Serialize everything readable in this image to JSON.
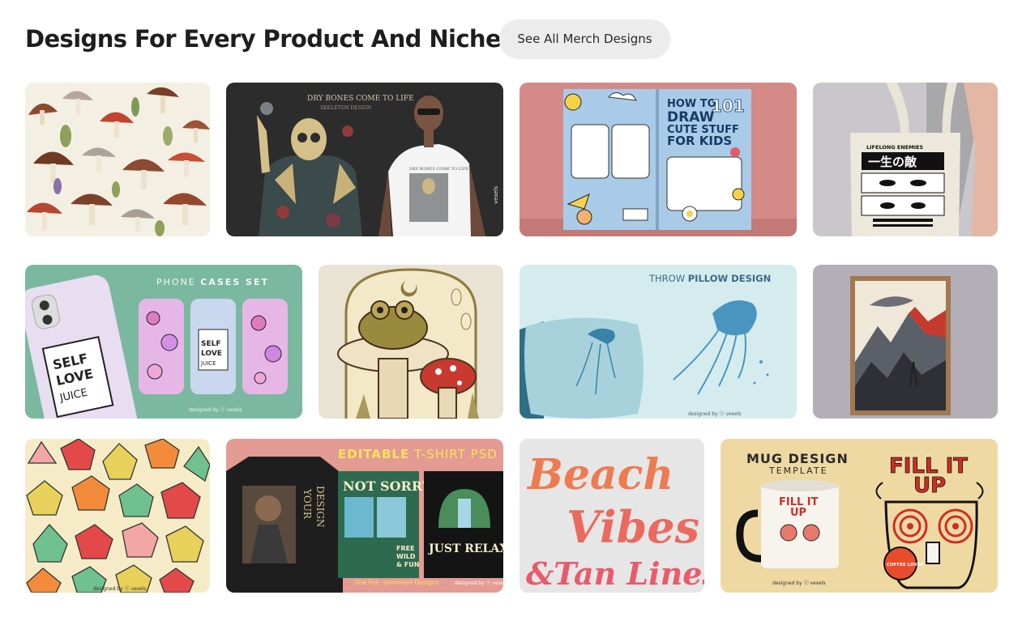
{
  "header": {
    "title": "Designs For Every Product And Niche",
    "see_all_label": "See All Merch Designs"
  },
  "designs": {
    "skeleton_tee": {
      "poster_text": "DRY BONES COME TO LIFE",
      "poster_sub": "SKELETON DESIGN",
      "shirt_text": "DRY BONES COME TO LIFE",
      "watermark": "vexels"
    },
    "kids_book": {
      "line1": "HOW TO",
      "line1_num": "101",
      "line2": "DRAW",
      "line3": "CUTE STUFF",
      "line4": "FOR KIDS"
    },
    "tote_bag": {
      "line1": "LIFELONG ENEMIES",
      "kanji": "一生の敵"
    },
    "phone_cases": {
      "heading_light": "PHONE ",
      "heading_bold": "CASES SET",
      "juice_1": "SELF",
      "juice_2": "LOVE",
      "juice_3": "JUICE",
      "watermark": "designed by ⓥ vexels"
    },
    "pillow": {
      "heading_light": "THROW ",
      "heading_bold": "PILLOW DESIGN",
      "watermark": "designed by ⓥ vexels"
    },
    "dice_pattern": {
      "watermark": "designed by ⓥ vexels"
    },
    "psd_template": {
      "heading_bold": "EDITABLE",
      "heading_light": " T-SHIRT PSD",
      "sweater_text_1": "YOUR",
      "sweater_text_2": "DESIGN",
      "card1_title": "NOT SORRY",
      "card1_sub_1": "FREE",
      "card1_sub_2": "WILD",
      "card1_sub_3": "& FUN",
      "card2_title": "JUST RELAX",
      "footer": "One Fun, Unlimited Designs",
      "watermark": "designed by ⓥ vexels"
    },
    "beach_lettering": {
      "line1": "Beach",
      "line2": "Vibes",
      "line3": "&Tan Lines"
    },
    "mug": {
      "heading": "MUG DESIGN",
      "subheading": "TEMPLATE",
      "art_1": "FILL IT",
      "art_2": "UP",
      "mug_art_1": "FILL IT",
      "mug_art_2": "UP",
      "badge": "COFFEE LOVER",
      "watermark": "designed by ⓥ vexels"
    }
  }
}
